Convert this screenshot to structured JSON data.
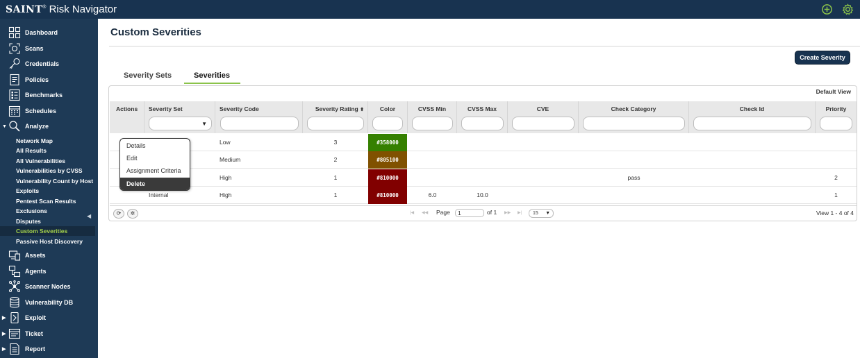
{
  "app": {
    "brand_logo": "SAINT",
    "brand_mark": "®",
    "brand_name": "Risk Navigator",
    "add_icon": "plus-circle-icon",
    "settings_icon": "gear-icon",
    "accent": "#8bc34a"
  },
  "sidebar": {
    "items": [
      {
        "label": "Dashboard",
        "icon": "dashboard-icon"
      },
      {
        "label": "Scans",
        "icon": "scan-icon"
      },
      {
        "label": "Credentials",
        "icon": "key-icon"
      },
      {
        "label": "Policies",
        "icon": "policy-icon"
      },
      {
        "label": "Benchmarks",
        "icon": "benchmark-icon"
      },
      {
        "label": "Schedules",
        "icon": "calendar-icon"
      },
      {
        "label": "Analyze",
        "icon": "magnifier-icon",
        "expanded": true
      }
    ],
    "analyze_sub": [
      "Network Map",
      "All Results",
      "All Vulnerabilities",
      "Vulnerabilities by CVSS",
      "Vulnerability Count by Host",
      "Exploits",
      "Pentest Scan Results",
      "Exclusions",
      "Disputes",
      "Custom Severities",
      "Passive Host Discovery"
    ],
    "active_sub": "Custom Severities",
    "items_after": [
      {
        "label": "Assets",
        "icon": "assets-icon"
      },
      {
        "label": "Agents",
        "icon": "agents-icon"
      },
      {
        "label": "Scanner Nodes",
        "icon": "nodes-icon"
      },
      {
        "label": "Vulnerability DB",
        "icon": "database-icon"
      },
      {
        "label": "Exploit",
        "icon": "exploit-icon",
        "collapsed": true
      },
      {
        "label": "Ticket",
        "icon": "ticket-icon",
        "collapsed": true
      },
      {
        "label": "Report",
        "icon": "report-icon",
        "collapsed": true
      }
    ]
  },
  "page": {
    "title": "Custom Severities",
    "create_button": "Create Severity",
    "tabs": [
      "Severity Sets",
      "Severities"
    ],
    "active_tab": "Severities",
    "default_view": "Default View"
  },
  "grid": {
    "columns": [
      "Actions",
      "Severity Set",
      "Severity Code",
      "Severity Rating",
      "Color",
      "CVSS Min",
      "CVSS Max",
      "CVE",
      "Check Category",
      "Check Id",
      "Priority"
    ],
    "rows": [
      {
        "set": "",
        "code": "Low",
        "rating": "3",
        "color": "#358000",
        "cvss_min": "",
        "cvss_max": "",
        "cve": "",
        "category": "",
        "check_id": "",
        "priority": ""
      },
      {
        "set": "",
        "code": "Medium",
        "rating": "2",
        "color": "#805100",
        "cvss_min": "",
        "cvss_max": "",
        "cve": "",
        "category": "",
        "check_id": "",
        "priority": ""
      },
      {
        "set": "",
        "code": "High",
        "rating": "1",
        "color": "#810000",
        "cvss_min": "",
        "cvss_max": "",
        "cve": "",
        "category": "pass",
        "check_id": "",
        "priority": "2"
      },
      {
        "set": "Internal",
        "code": "High",
        "rating": "1",
        "color": "#810000",
        "cvss_min": "6.0",
        "cvss_max": "10.0",
        "cve": "",
        "category": "",
        "check_id": "",
        "priority": "1"
      }
    ],
    "pager": {
      "page_label": "Page",
      "page_value": "1",
      "of_label": "of 1",
      "page_size": "15",
      "view_text": "View 1 - 4 of 4"
    }
  },
  "context_menu": {
    "items": [
      "Details",
      "Edit",
      "Assignment Criteria",
      "Delete"
    ],
    "highlighted": "Delete"
  }
}
